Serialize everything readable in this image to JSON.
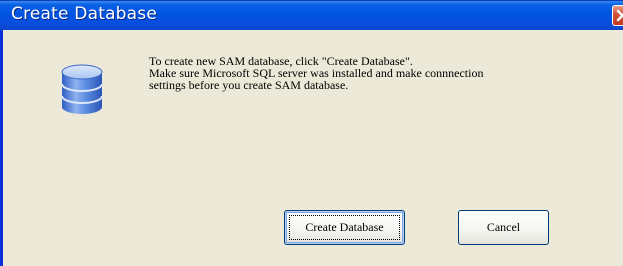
{
  "dialog": {
    "title": "Create Database",
    "message_lines": [
      "To create new SAM database, click \"Create Database\".",
      "Make sure Microsoft SQL server was installed and make connnection",
      "settings before you create SAM database."
    ],
    "icon": "database-icon",
    "close_icon": "close-icon"
  },
  "buttons": {
    "create_label": "Create Database",
    "cancel_label": "Cancel"
  },
  "colors": {
    "titlebar": "#0054e3",
    "dialog_background": "#ece9d8",
    "close_button": "#d2553a",
    "icon_blue": "#4a7fd8"
  }
}
